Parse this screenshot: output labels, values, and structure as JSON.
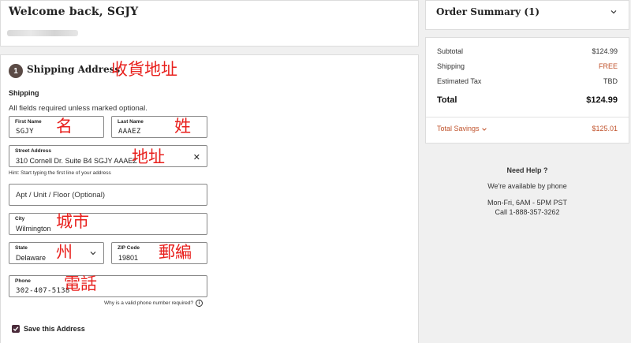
{
  "welcome": {
    "title": "Welcome back, SGJY"
  },
  "shipping": {
    "step": "1",
    "title": "Shipping Address",
    "title_annotation": "收貨地址",
    "subtitle": "Shipping",
    "required_note": "All fields required unless marked optional.",
    "first_name": {
      "label": "First Name",
      "value": "SGJY",
      "annotation": "名"
    },
    "last_name": {
      "label": "Last Name",
      "value": "AAAEZ",
      "annotation": "姓"
    },
    "street": {
      "label": "Street Address",
      "value": "310 Cornell Dr. Suite B4 SGJY AAAEZ",
      "annotation": "地址",
      "hint": "Hint: Start typing the first line of your address"
    },
    "apt": {
      "placeholder": "Apt / Unit / Floor (Optional)"
    },
    "city": {
      "label": "City",
      "value": "Wilmington",
      "annotation": "城市"
    },
    "state": {
      "label": "State",
      "value": "Delaware",
      "annotation": "州"
    },
    "zip": {
      "label": "ZIP Code",
      "value": "19801",
      "annotation": "郵編"
    },
    "phone": {
      "label": "Phone",
      "value": "302-407-5138",
      "annotation": "電話",
      "why": "Why is a valid phone number required?"
    },
    "save_label": "Save this Address"
  },
  "order_summary": {
    "title": "Order Summary (1)",
    "subtotal_label": "Subtotal",
    "subtotal": "$124.99",
    "shipping_label": "Shipping",
    "shipping": "FREE",
    "tax_label": "Estimated Tax",
    "tax": "TBD",
    "total_label": "Total",
    "total": "$124.99",
    "savings_label": "Total Savings",
    "savings": "$125.01"
  },
  "help": {
    "title": "Need Help ?",
    "line1": "We're available by phone",
    "hours": "Mon-Fri, 6AM - 5PM PST",
    "phone": "Call 1-888-357-3262"
  },
  "colors": {
    "accent": "#c0522b",
    "annotation": "#e8201d",
    "checkbox": "#4a2b3a"
  }
}
